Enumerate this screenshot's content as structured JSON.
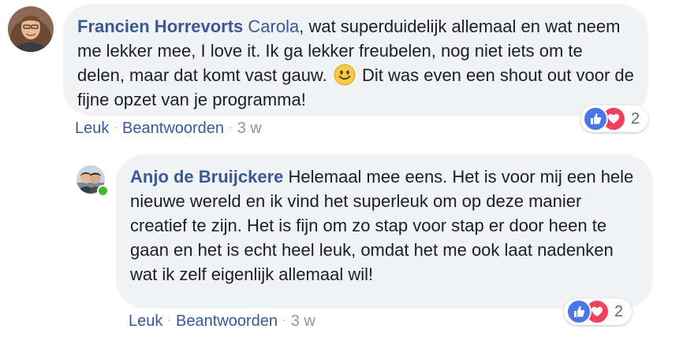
{
  "comments": [
    {
      "author": "Francien Horrevorts",
      "mention": "Carola",
      "text_before_emoji": ", wat superduidelijk allemaal en wat neem me lekker mee, I love it. Ik ga lekker freubelen, nog niet iets om te delen, maar dat komt vast gauw.",
      "emoji": "smiley-emoji",
      "text_after_emoji": " Dit was even een shout out voor de fijne opzet van je programma!",
      "actions": {
        "like": "Leuk",
        "reply": "Beantwoorden",
        "separator": "·",
        "time": "3 w"
      },
      "reactions": {
        "icons": [
          "like-icon",
          "love-icon"
        ],
        "count": "2"
      }
    }
  ],
  "replies": [
    {
      "author": "Anjo de Bruijckere",
      "text": "Helemaal mee eens. Het is voor mij een hele nieuwe wereld en ik vind het superleuk om op deze manier creatief te zijn. Het is fijn om zo stap voor stap er door heen te gaan en het is echt heel leuk, omdat het me ook laat nadenken wat ik zelf eigenlijk allemaal wil!",
      "online": true,
      "actions": {
        "like": "Leuk",
        "reply": "Beantwoorden",
        "separator": "·",
        "time": "3 w"
      },
      "reactions": {
        "icons": [
          "like-icon",
          "love-icon"
        ],
        "count": "2"
      }
    }
  ],
  "colors": {
    "link": "#385898",
    "bubble": "#f2f3f5",
    "like": "#4a76e8",
    "love": "#f0405e",
    "online": "#42b72a"
  }
}
